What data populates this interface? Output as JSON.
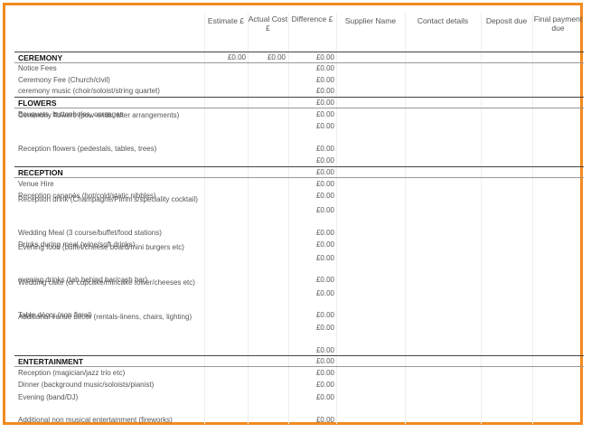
{
  "headers": {
    "estimate": "Estimate £",
    "actual": "Actual Cost £",
    "difference": "Difference £",
    "supplier": "Supplier Name",
    "contact": "Contact details",
    "deposit": "Deposit due",
    "final": "Final payment due"
  },
  "rows": [
    {
      "label": "CEREMONY",
      "type": "section",
      "estimate": "£0.00",
      "actual": "£0.00",
      "difference": "£0.00"
    },
    {
      "label": "Notice Fees",
      "difference": "£0.00"
    },
    {
      "label": "Ceremony Fee (Church/civil)",
      "difference": "£0.00"
    },
    {
      "label": "ceremony music (choir/soloist/string quartet)",
      "difference": "£0.00"
    },
    {
      "label": "FLOWERS",
      "type": "section",
      "difference": "£0.00"
    },
    {
      "label": "Bouquets, buttonholes, corsages",
      "difference": "£0.00"
    },
    {
      "label": "Ceremony flowers (pew-ends, alter arrangements)",
      "difference": "£0.00"
    },
    {
      "label": "Reception flowers (pedestals, tables, trees)",
      "difference": "£0.00"
    },
    {
      "label": "",
      "difference": "£0.00"
    },
    {
      "label": "RECEPTION",
      "type": "section",
      "difference": "£0.00"
    },
    {
      "label": "Venue Hire",
      "difference": "£0.00"
    },
    {
      "label": "Reception canapés (hot/cold/static nibbles)",
      "difference": "£0.00"
    },
    {
      "label": "Reception drink (Champagne/Pimm's/speciality cocktail)",
      "difference": "£0.00"
    },
    {
      "label": "Wedding Meal (3 course/buffet/food stations)",
      "difference": "£0.00"
    },
    {
      "label": "Drinks during meal (wine/soft drinks)",
      "difference": "£0.00"
    },
    {
      "label": "Evening food (buffet/cheese board/mini burgers etc)",
      "difference": "£0.00"
    },
    {
      "label": "evening drinks (tab behind bar/cash bar)",
      "difference": "£0.00"
    },
    {
      "label": "Wedding cake (or cupcake/mincake tower/cheeses etc)",
      "difference": "£0.00"
    },
    {
      "label": "Table décor (non floral)",
      "difference": "£0.00"
    },
    {
      "label": "Additional venue décor (rentals-linens, chairs, lighting)",
      "difference": "£0.00"
    },
    {
      "label": "",
      "difference": "£0.00"
    },
    {
      "label": "ENTERTAINMENT",
      "type": "section",
      "difference": "£0.00"
    },
    {
      "label": "Reception (magician/jazz trio etc)",
      "difference": "£0.00"
    },
    {
      "label": "Dinner (background music/soloists/pianist)",
      "difference": "£0.00"
    },
    {
      "label": "Evening (band/DJ)",
      "difference": "£0.00"
    },
    {
      "label": "Additional non musical entertainment (fireworks)",
      "difference": "£0.00"
    }
  ]
}
